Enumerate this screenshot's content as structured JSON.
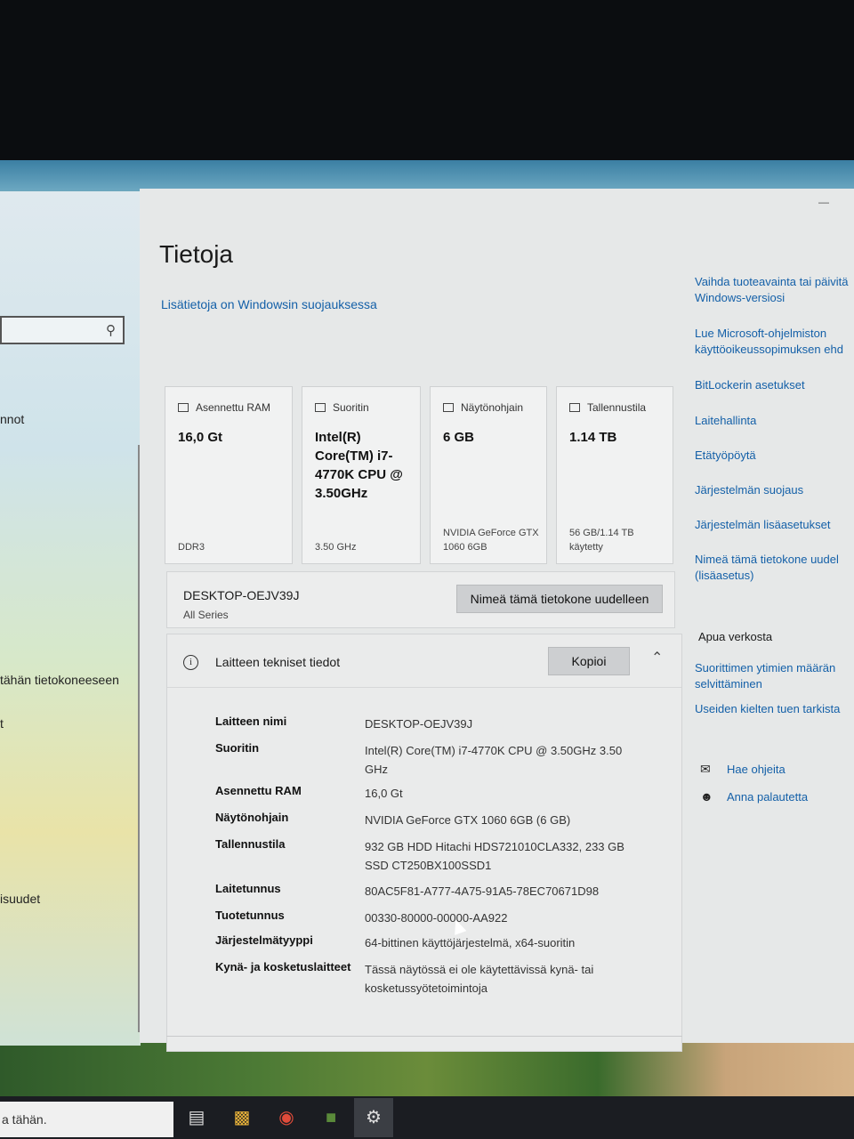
{
  "window": {
    "title": "Tietoja"
  },
  "security_link": "Lisätietoja on Windowsin suojauksessa",
  "left_pane": {
    "items": [
      "nnot",
      "tähän tietokoneeseen",
      "t",
      "isuudet"
    ]
  },
  "cards": [
    {
      "heading": "Asennettu RAM",
      "value": "16,0 Gt",
      "foot": "DDR3",
      "icon": "ram-icon"
    },
    {
      "heading": "Suoritin",
      "value": "Intel(R) Core(TM) i7-4770K CPU @ 3.50GHz",
      "foot": "3.50 GHz",
      "icon": "cpu-icon"
    },
    {
      "heading": "Näytönohjain",
      "value": "6 GB",
      "foot": "NVIDIA GeForce GTX 1060 6GB",
      "icon": "gpu-icon"
    },
    {
      "heading": "Tallennustila",
      "value": "1.14 TB",
      "foot": "56 GB/1.14 TB käytetty",
      "icon": "storage-icon"
    }
  ],
  "pc": {
    "name": "DESKTOP-OEJV39J",
    "series": "All Series",
    "rename_label": "Nimeä tämä tietokone uudelleen"
  },
  "specs": {
    "title": "Laitteen tekniset tiedot",
    "copy_label": "Kopioi",
    "rows": [
      {
        "label": "Laitteen nimi",
        "value": "DESKTOP-OEJV39J"
      },
      {
        "label": "Suoritin",
        "value": "Intel(R) Core(TM) i7-4770K CPU @ 3.50GHz 3.50 GHz"
      },
      {
        "label": "Asennettu RAM",
        "value": "16,0 Gt"
      },
      {
        "label": "Näytönohjain",
        "value": "NVIDIA GeForce GTX 1060 6GB (6 GB)"
      },
      {
        "label": "Tallennustila",
        "value": "932 GB HDD Hitachi HDS721010CLA332, 233 GB SSD CT250BX100SSD1"
      },
      {
        "label": "Laitetunnus",
        "value": "80AC5F81-A777-4A75-91A5-78EC70671D98"
      },
      {
        "label": "Tuotetunnus",
        "value": "00330-80000-00000-AA922"
      },
      {
        "label": "Järjestelmätyyppi",
        "value": "64-bittinen käyttöjärjestelmä, x64-suoritin"
      },
      {
        "label": "Kynä- ja kosketuslaitteet",
        "value": "Tässä näytössä ei ole käytettävissä kynä- tai kosketussyötetoimintoja"
      }
    ]
  },
  "right": {
    "links_top": [
      "Vaihda tuoteavainta tai päivitä Windows-versiosi",
      "Lue Microsoft-ohjelmiston käyttöoikeussopimuksen ehd",
      "BitLockerin asetukset",
      "Laitehallinta",
      "Etätyöpöytä",
      "Järjestelmän suojaus",
      "Järjestelmän lisäasetukset",
      "Nimeä tämä tietokone uudel (lisäasetus)"
    ],
    "help_heading": "Apua verkosta",
    "help_links": [
      "Suorittimen ytimien määrän selvittäminen",
      "Useiden kielten tuen tarkista"
    ],
    "get_help": "Hae ohjeita",
    "feedback": "Anna palautetta"
  },
  "taskbar": {
    "search_placeholder": "a tähän."
  }
}
